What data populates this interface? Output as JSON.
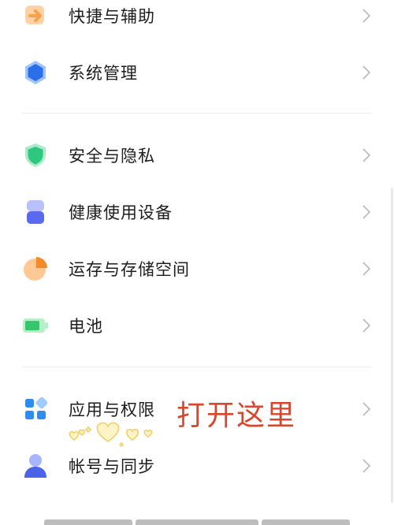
{
  "settings": {
    "items": [
      {
        "label": "快捷与辅助",
        "icon": "arrow-right-square-icon",
        "color": "#f7a24b"
      },
      {
        "label": "系统管理",
        "icon": "hexagon-icon",
        "color": "#2b6fe8"
      },
      {
        "label": "安全与隐私",
        "icon": "shield-icon",
        "color": "#2fc77f"
      },
      {
        "label": "健康使用设备",
        "icon": "hourglass-icon",
        "color": "#5a6af0"
      },
      {
        "label": "运存与存储空间",
        "icon": "pie-chart-icon",
        "color": "#f58a2a"
      },
      {
        "label": "电池",
        "icon": "battery-icon",
        "color": "#35c86a"
      },
      {
        "label": "应用与权限",
        "icon": "apps-grid-icon",
        "color": "#2f8cf0"
      },
      {
        "label": "帐号与同步",
        "icon": "user-icon",
        "color": "#4a63e8"
      }
    ]
  },
  "annotation": {
    "text": "打开这里",
    "color": "#d9462b"
  }
}
